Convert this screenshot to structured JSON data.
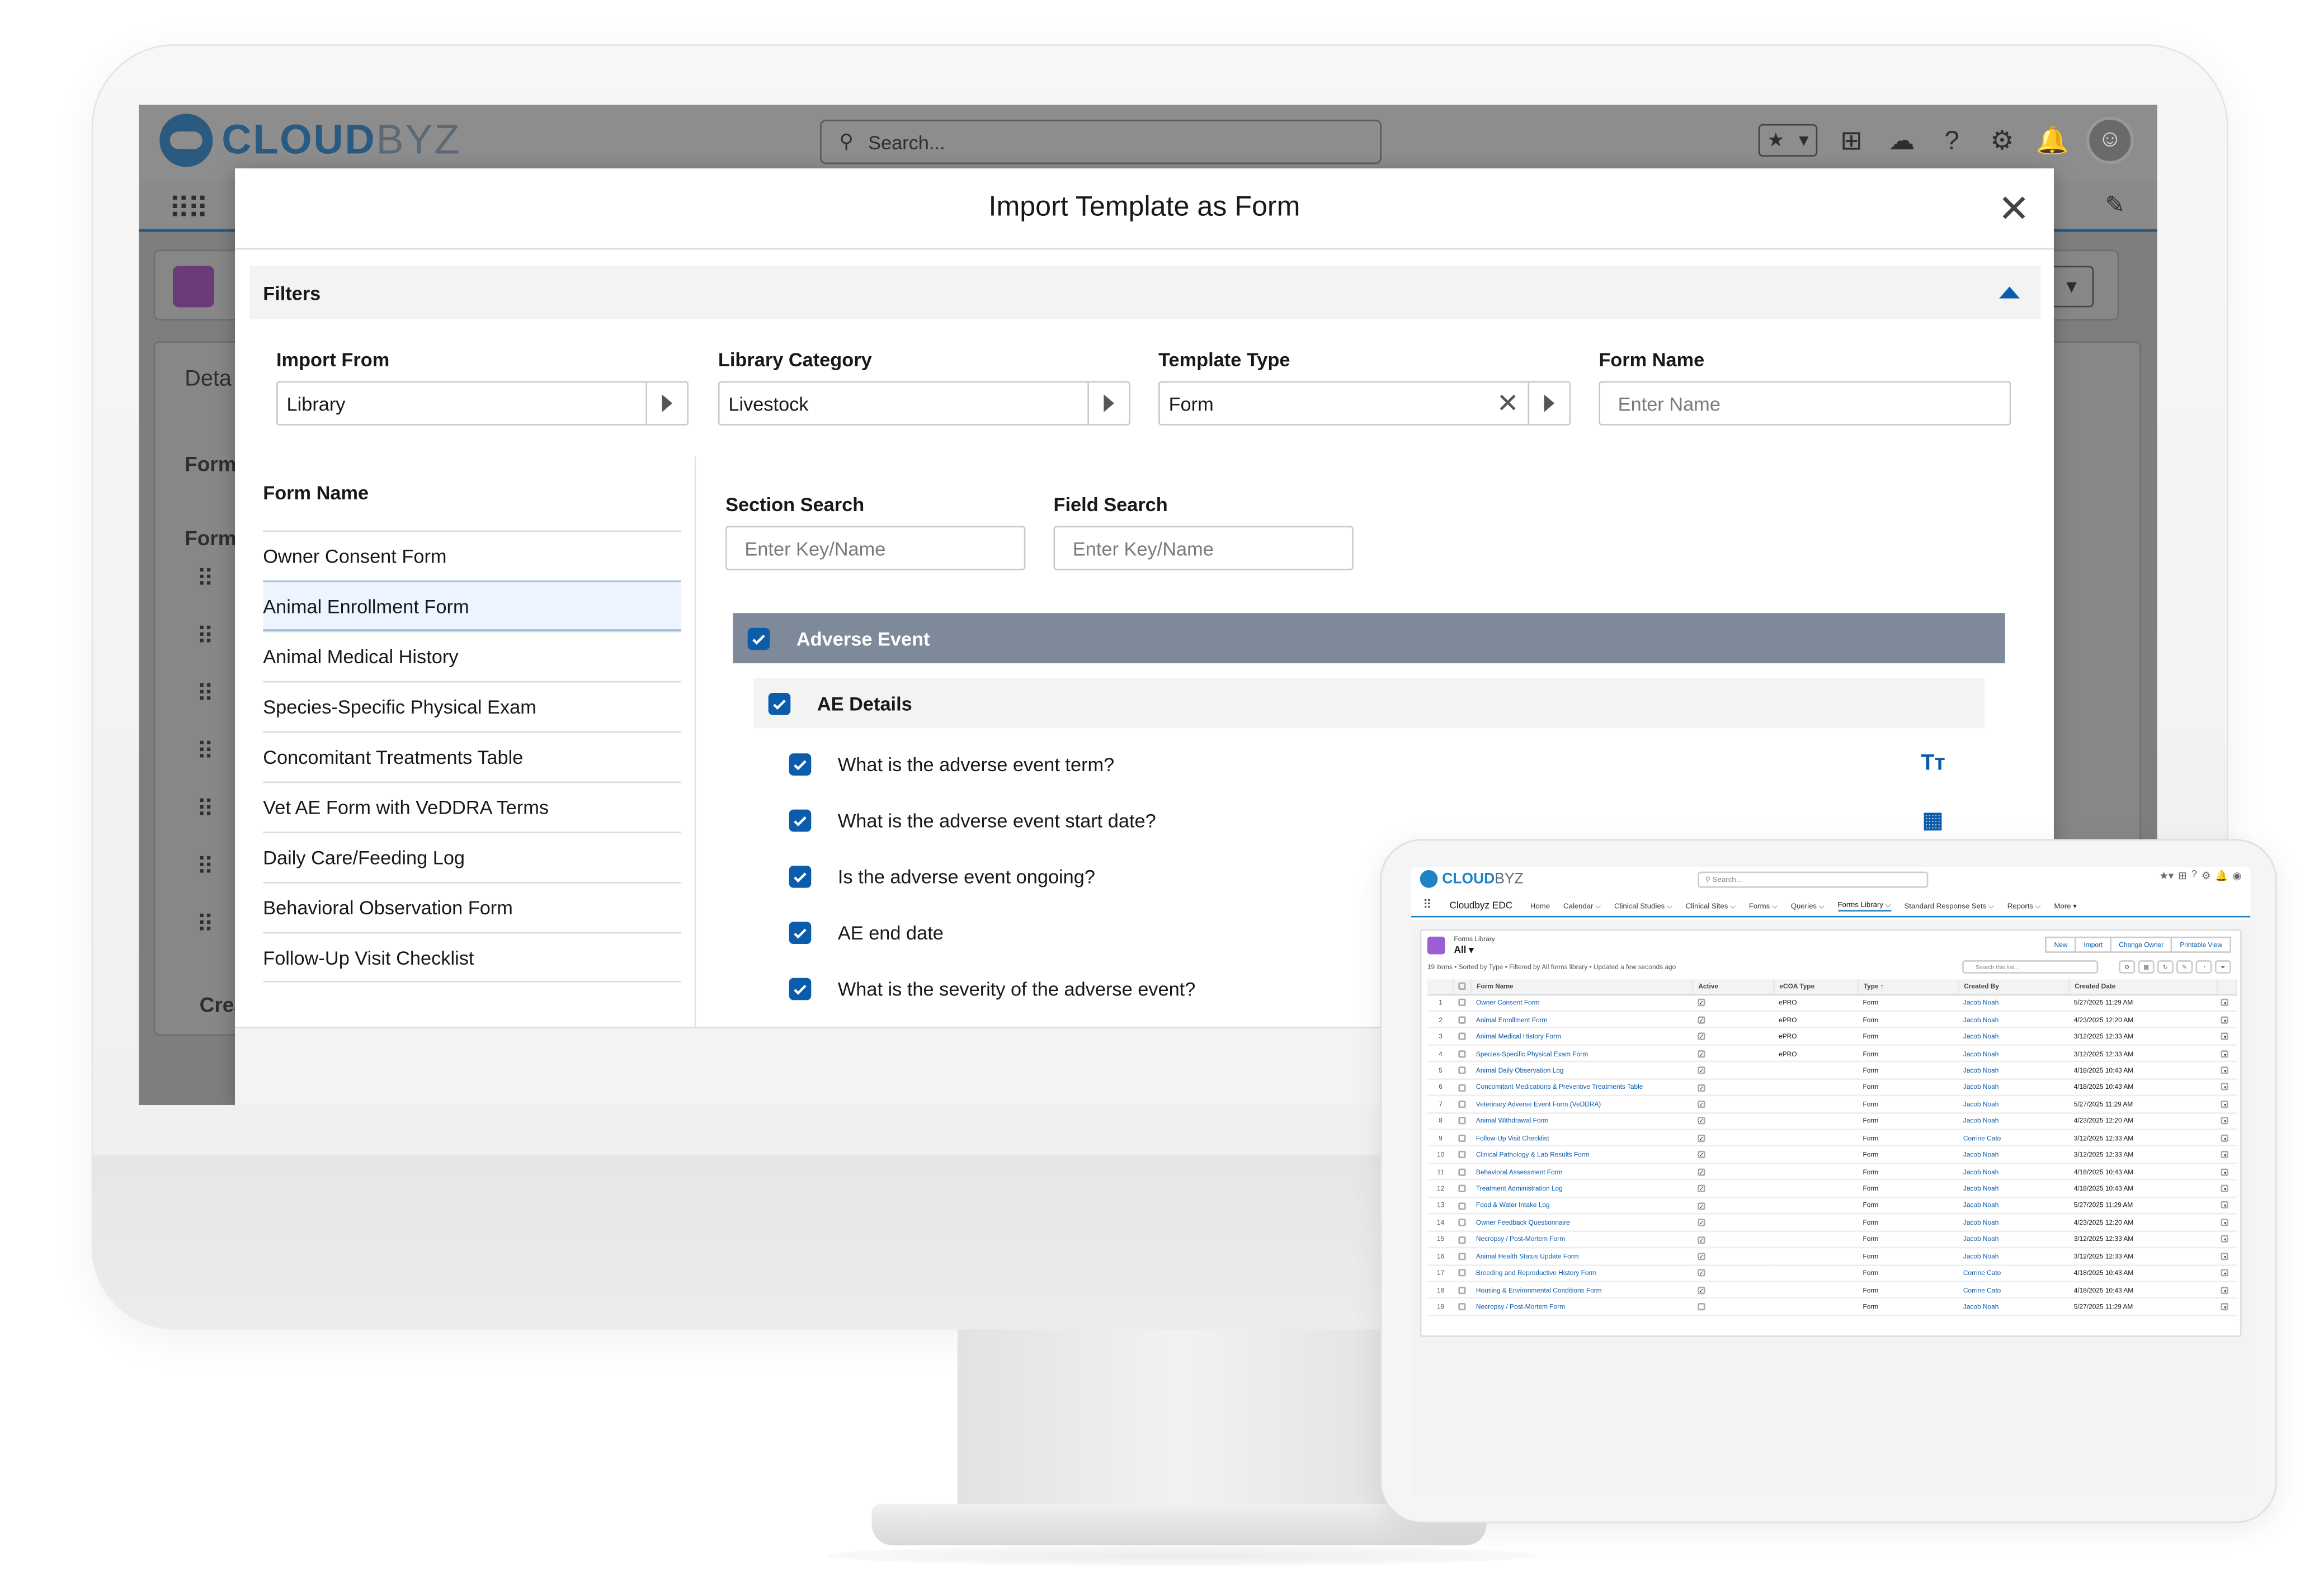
{
  "app": {
    "brand_main": "CLOUD",
    "brand_accent": "BYZ",
    "search_placeholder": "Search...",
    "bg_labels": {
      "details": "Deta",
      "form1": "Form",
      "form2": "Form",
      "create": "Crea"
    }
  },
  "modal": {
    "title": "Import Template as Form",
    "close_label": "✕",
    "filters_label": "Filters",
    "import_from": {
      "label": "Import From",
      "value": "Library"
    },
    "library_category": {
      "label": "Library Category",
      "value": "Livestock"
    },
    "template_type": {
      "label": "Template Type",
      "value": "Form"
    },
    "form_name_filter": {
      "label": "Form Name",
      "placeholder": "Enter Name"
    },
    "list_header": "Form Name",
    "forms": [
      "Owner Consent Form",
      "Animal Enrollment Form",
      "Animal Medical History",
      "Species-Specific Physical Exam",
      "Concomitant Treatments Table",
      "Vet AE Form with VeDDRA Terms",
      "Daily Care/Feeding Log",
      "Behavioral Observation Form",
      "Follow-Up Visit Checklist"
    ],
    "section_search": {
      "label": "Section Search",
      "placeholder": "Enter Key/Name"
    },
    "field_search": {
      "label": "Field Search",
      "placeholder": "Enter Key/Name"
    },
    "section": "Adverse Event",
    "subsection": "AE Details",
    "questions": [
      {
        "text": "What is the adverse event term?",
        "icon": "text-type-icon"
      },
      {
        "text": "What is the adverse event start date?",
        "icon": "calendar-icon"
      },
      {
        "text": "Is the adverse event ongoing?",
        "icon": ""
      },
      {
        "text": "AE end date",
        "icon": ""
      },
      {
        "text": "What is the severity of the adverse event?",
        "icon": ""
      }
    ]
  },
  "tablet": {
    "brand_main": "CLOUD",
    "brand_accent": "BYZ",
    "search_placeholder": "Search...",
    "app_name": "Cloudbyz EDC",
    "nav": [
      "Home",
      "Calendar ⌵",
      "Clinical Studies ⌵",
      "Clinical Sites ⌵",
      "Forms ⌵",
      "Queries ⌵",
      "Forms Library ⌵",
      "Standard Response Sets ⌵",
      "Reports ⌵",
      "More ▾"
    ],
    "active_nav": "Forms Library ⌵",
    "list_object": "Forms Library",
    "list_view": "All ▾",
    "buttons": [
      "New",
      "Import",
      "Change Owner",
      "Printable View"
    ],
    "meta": "19 items • Sorted by Type • Filtered by All forms library • Updated a few seconds ago",
    "list_search_placeholder": "Search this list...",
    "columns": [
      "Form Name",
      "Active",
      "eCOA Type",
      "Type ↑",
      "Created By",
      "Created Date"
    ],
    "rows": [
      {
        "n": "1",
        "name": "Owner Consent Form",
        "active": true,
        "ecoa": "ePRO",
        "type": "Form",
        "by": "Jacob Noah",
        "date": "5/27/2025 11:29 AM"
      },
      {
        "n": "2",
        "name": "Animal Enrollment Form",
        "active": true,
        "ecoa": "ePRO",
        "type": "Form",
        "by": "Jacob Noah",
        "date": "4/23/2025 12:20 AM"
      },
      {
        "n": "3",
        "name": "Animal Medical History Form",
        "active": true,
        "ecoa": "ePRO",
        "type": "Form",
        "by": "Jacob Noah",
        "date": "3/12/2025 12:33 AM"
      },
      {
        "n": "4",
        "name": "Species-Specific Physical Exam Form",
        "active": true,
        "ecoa": "ePRO",
        "type": "Form",
        "by": "Jacob Noah",
        "date": "3/12/2025 12:33 AM"
      },
      {
        "n": "5",
        "name": "Animal Daily Observation Log",
        "active": true,
        "ecoa": "",
        "type": "Form",
        "by": "Jacob Noah",
        "date": "4/18/2025 10:43 AM"
      },
      {
        "n": "6",
        "name": "Concomitant Medications & Preventive Treatments Table",
        "active": true,
        "ecoa": "",
        "type": "Form",
        "by": "Jacob Noah",
        "date": "4/18/2025 10:43 AM"
      },
      {
        "n": "7",
        "name": "Veterinary Adverse Event Form (VeDDRA)",
        "active": true,
        "ecoa": "",
        "type": "Form",
        "by": "Jacob Noah",
        "date": "5/27/2025 11:29 AM"
      },
      {
        "n": "8",
        "name": "Animal Withdrawal Form",
        "active": true,
        "ecoa": "",
        "type": "Form",
        "by": "Jacob Noah",
        "date": "4/23/2025 12:20 AM"
      },
      {
        "n": "9",
        "name": "Follow-Up Visit Checklist",
        "active": true,
        "ecoa": "",
        "type": "Form",
        "by": "Corrine Cato",
        "date": "3/12/2025 12:33 AM"
      },
      {
        "n": "10",
        "name": "Clinical Pathology & Lab Results Form",
        "active": true,
        "ecoa": "",
        "type": "Form",
        "by": "Jacob Noah",
        "date": "3/12/2025 12:33 AM"
      },
      {
        "n": "11",
        "name": "Behavioral Assessment Form",
        "active": true,
        "ecoa": "",
        "type": "Form",
        "by": "Jacob Noah",
        "date": "4/18/2025 10:43 AM"
      },
      {
        "n": "12",
        "name": "Treatment Administration Log",
        "active": true,
        "ecoa": "",
        "type": "Form",
        "by": "Jacob Noah",
        "date": "4/18/2025 10:43 AM"
      },
      {
        "n": "13",
        "name": "Food & Water Intake Log",
        "active": true,
        "ecoa": "",
        "type": "Form",
        "by": "Jacob Noah",
        "date": "5/27/2025 11:29 AM"
      },
      {
        "n": "14",
        "name": "Owner Feedback Questionnaire",
        "active": true,
        "ecoa": "",
        "type": "Form",
        "by": "Jacob Noah",
        "date": "4/23/2025 12:20 AM"
      },
      {
        "n": "15",
        "name": "Necropsy / Post-Mortem Form",
        "active": true,
        "ecoa": "",
        "type": "Form",
        "by": "Jacob Noah",
        "date": "3/12/2025 12:33 AM"
      },
      {
        "n": "16",
        "name": "Animal Health Status Update Form",
        "active": true,
        "ecoa": "",
        "type": "Form",
        "by": "Jacob Noah",
        "date": "3/12/2025 12:33 AM"
      },
      {
        "n": "17",
        "name": "Breeding and Reproductive History Form",
        "active": true,
        "ecoa": "",
        "type": "Form",
        "by": "Corrine Cato",
        "date": "4/18/2025 10:43 AM"
      },
      {
        "n": "18",
        "name": "Housing & Environmental Conditions Form",
        "active": true,
        "ecoa": "",
        "type": "Form",
        "by": "Corrine Cato",
        "date": "4/18/2025 10:43 AM"
      },
      {
        "n": "19",
        "name": "Necropsy / Post-Mortem Form",
        "active": false,
        "ecoa": "",
        "type": "Form",
        "by": "Jacob Noah",
        "date": "5/27/2025 11:29 AM"
      }
    ]
  },
  "colors": {
    "brand_blue": "#0b5cab",
    "section_bg": "#7e8a9a",
    "overlay": "#7e7e7e"
  }
}
